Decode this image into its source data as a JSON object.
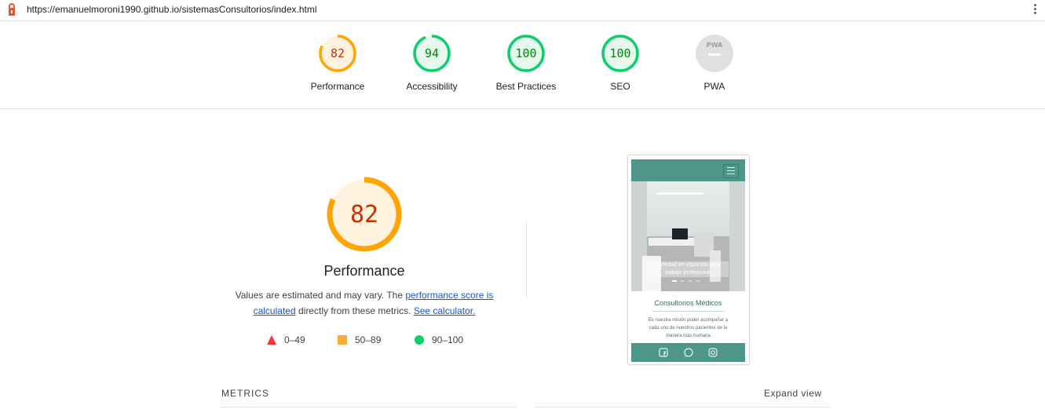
{
  "browser": {
    "url": "https://emanuelmoroni1990.github.io/sistemasConsultorios/index.html",
    "lock_icon": "lighthouse-icon",
    "menu_icon": "kebab-menu-icon"
  },
  "gauges": [
    {
      "score": "82",
      "label": "Performance",
      "value": 82,
      "color": "#ffa400",
      "fill": "#fff3e0",
      "text_color": "#c33300"
    },
    {
      "score": "94",
      "label": "Accessibility",
      "value": 94,
      "color": "#0cce6b",
      "fill": "#e5f9ee",
      "text_color": "#008800"
    },
    {
      "score": "100",
      "label": "Best Practices",
      "value": 100,
      "color": "#0cce6b",
      "fill": "#e5f9ee",
      "text_color": "#008800"
    },
    {
      "score": "100",
      "label": "SEO",
      "value": 100,
      "color": "#0cce6b",
      "fill": "#e5f9ee",
      "text_color": "#008800"
    },
    {
      "score": "PWA",
      "label": "PWA",
      "value": 0,
      "color": "#dddddd",
      "fill": "#e0e0e0",
      "text_color": "#9e9e9e"
    }
  ],
  "performance": {
    "score": "82",
    "value": 82,
    "title": "Performance",
    "desc_prefix": "Values are estimated and may vary. The ",
    "desc_link1": "performance score is calculated",
    "desc_middle": " directly from these metrics. ",
    "desc_link2": "See calculator."
  },
  "legend": [
    {
      "range": "0–49",
      "icon": "red-triangle-icon",
      "color": "#ff3333"
    },
    {
      "range": "50–89",
      "icon": "orange-square-icon",
      "color": "#ffaa33"
    },
    {
      "range": "90–100",
      "icon": "green-circle-icon",
      "color": "#0cce6b"
    }
  ],
  "screenshot": {
    "caption": "Variedad en espacios para trabajo profesional",
    "title": "Consultorios Médicos",
    "text": "Es nuestra misión poder acompañar a cada uno de nuestros pacientes de la manera más humana",
    "footer_icons": [
      "facebook-icon",
      "whatsapp-icon",
      "instagram-icon"
    ]
  },
  "metrics": {
    "heading": "METRICS",
    "expand_label": "Expand view"
  }
}
